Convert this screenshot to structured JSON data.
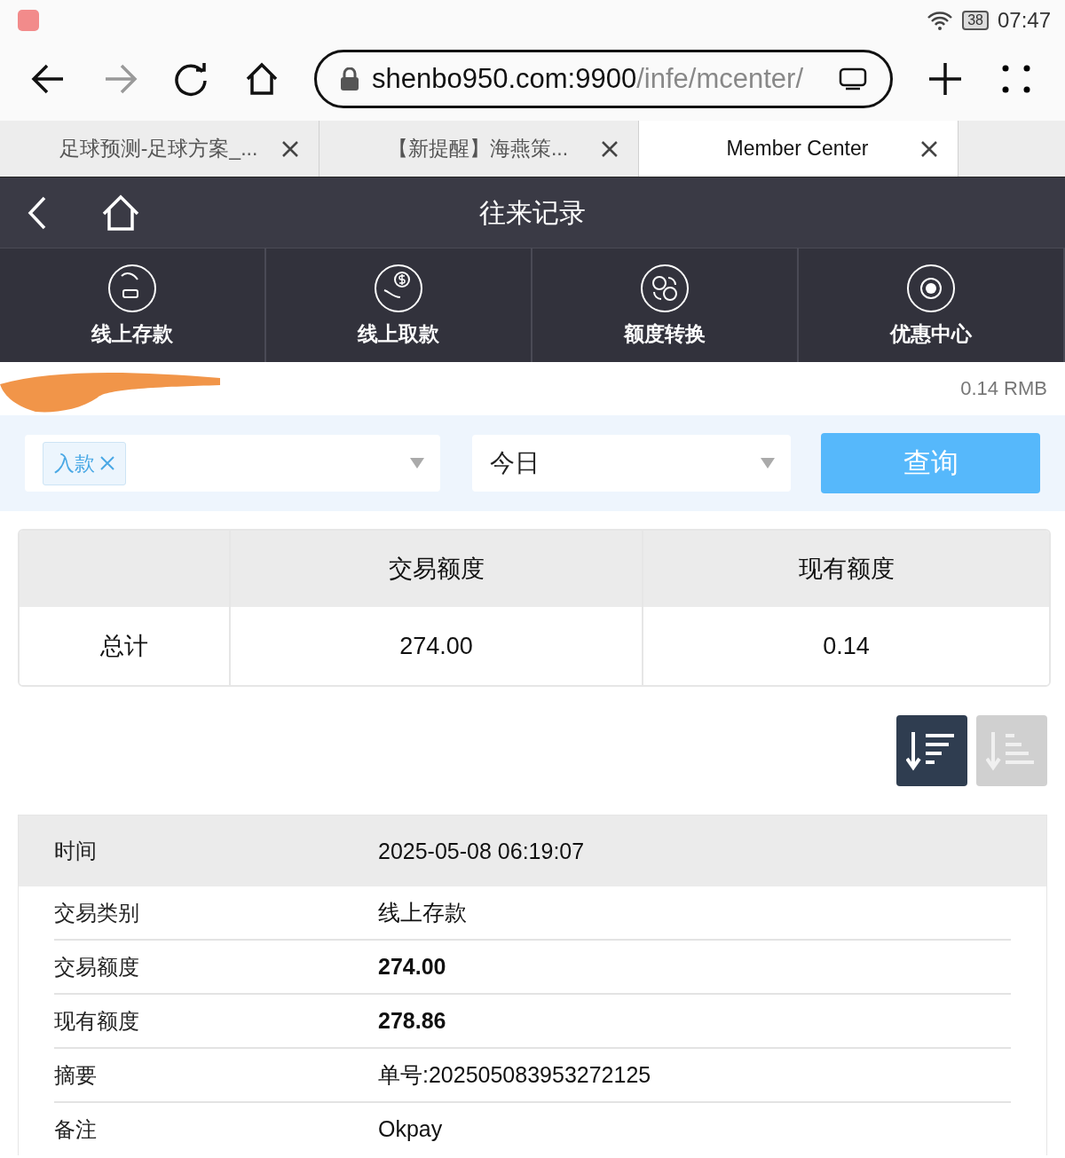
{
  "status_bar": {
    "battery": "38",
    "time": "07:47"
  },
  "address_bar": {
    "host": "shenbo950.com:9900",
    "path": "/infe/mcenter/"
  },
  "browser_tabs": [
    {
      "title": "足球预测-足球方案_...",
      "selected": false
    },
    {
      "title": "【新提醒】海燕策...",
      "selected": false
    },
    {
      "title": "Member Center",
      "selected": true
    }
  ],
  "header": {
    "title": "往来记录"
  },
  "nav": [
    {
      "label": "线上存款",
      "kind": "deposit"
    },
    {
      "label": "线上取款",
      "kind": "withdraw"
    },
    {
      "label": "额度转换",
      "kind": "transfer"
    },
    {
      "label": "优惠中心",
      "kind": "promo"
    }
  ],
  "account": {
    "balance": "0.14 RMB"
  },
  "filter": {
    "type_tag": "入款",
    "period": "今日",
    "query_button": "查询"
  },
  "summary": {
    "columns": [
      "交易额度",
      "现有额度"
    ],
    "row": {
      "label": "总计",
      "cells": [
        "274.00",
        "0.14"
      ]
    }
  },
  "sort_buttons": [
    {
      "kind": "desc",
      "selected": true
    },
    {
      "kind": "asc",
      "selected": false
    }
  ],
  "record": [
    {
      "label": "时间",
      "value": "2025-05-08 06:19:07",
      "kind": "head"
    },
    {
      "label": "交易类别",
      "value": "线上存款",
      "kind": "plain"
    },
    {
      "label": "交易额度",
      "value": "274.00",
      "kind": "bold"
    },
    {
      "label": "现有额度",
      "value": "278.86",
      "kind": "bold"
    },
    {
      "label": "摘要",
      "value": "单号:202505083953272125",
      "kind": "plain"
    },
    {
      "label": "备注",
      "value": "Okpay",
      "kind": "plain"
    }
  ]
}
